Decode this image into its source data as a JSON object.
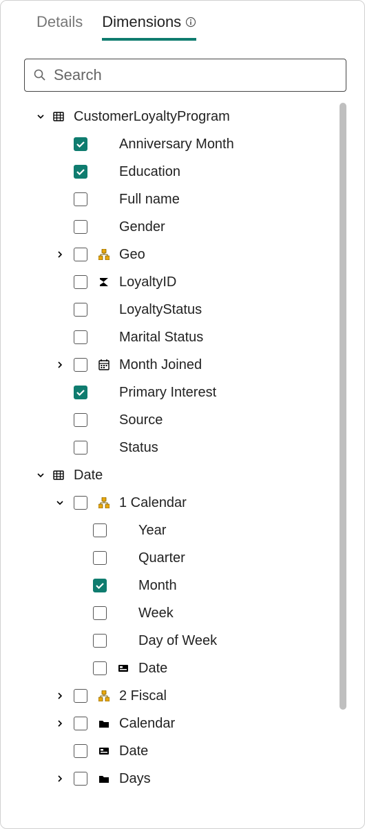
{
  "tabs": {
    "details": "Details",
    "dimensions": "Dimensions"
  },
  "search": {
    "placeholder": "Search"
  },
  "tree": {
    "clp": {
      "label": "CustomerLoyaltyProgram"
    },
    "anniv": {
      "label": "Anniversary Month"
    },
    "edu": {
      "label": "Education"
    },
    "fullname": {
      "label": "Full name"
    },
    "gender": {
      "label": "Gender"
    },
    "geo": {
      "label": "Geo"
    },
    "loyaltyid": {
      "label": "LoyaltyID"
    },
    "loystatus": {
      "label": "LoyaltyStatus"
    },
    "marital": {
      "label": "Marital Status"
    },
    "monthjoined": {
      "label": "Month Joined"
    },
    "priminterest": {
      "label": "Primary Interest"
    },
    "source": {
      "label": "Source"
    },
    "status": {
      "label": "Status"
    },
    "date": {
      "label": "Date"
    },
    "cal1": {
      "label": "1 Calendar"
    },
    "year": {
      "label": "Year"
    },
    "quarter": {
      "label": "Quarter"
    },
    "month": {
      "label": "Month"
    },
    "week": {
      "label": "Week"
    },
    "dow": {
      "label": "Day of Week"
    },
    "cal1date": {
      "label": "Date"
    },
    "fiscal2": {
      "label": "2 Fiscal"
    },
    "calendar": {
      "label": "Calendar"
    },
    "datefield": {
      "label": "Date"
    },
    "days": {
      "label": "Days"
    }
  }
}
